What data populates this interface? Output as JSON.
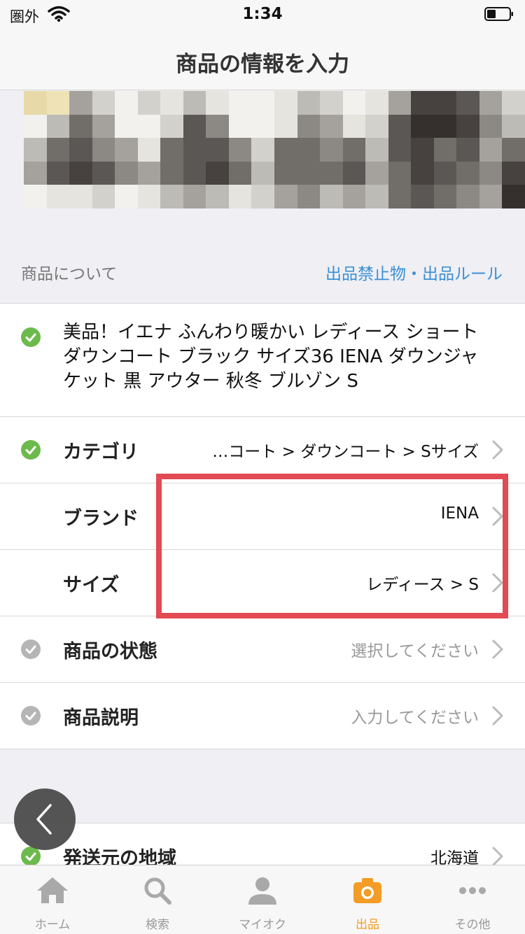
{
  "status_bar": {
    "carrier": "圏外",
    "time": "1:34"
  },
  "nav": {
    "title": "商品の情報を入力"
  },
  "section": {
    "label": "商品について",
    "link": "出品禁止物・出品ルール"
  },
  "listing": {
    "title": "美品！イエナ ふんわり暖かい レディース ショートダウンコート ブラック サイズ36 IENA ダウンジャケット 黒 アウター 秋冬 ブルゾン S"
  },
  "rows": [
    {
      "label": "カテゴリ",
      "value": "…コート > ダウンコート > Sサイズ",
      "status": "complete"
    },
    {
      "label": "ブランド",
      "value": "IENA",
      "status": "none"
    },
    {
      "label": "サイズ",
      "value": "レディース > S",
      "status": "none"
    },
    {
      "label": "商品の状態",
      "value": "選択してください",
      "status": "incomplete"
    },
    {
      "label": "商品説明",
      "value": "入力してください",
      "status": "incomplete"
    },
    {
      "label": "発送元の地域",
      "value": "北海道",
      "status": "complete"
    }
  ],
  "tabs": [
    {
      "label": "ホーム",
      "icon": "home-icon",
      "active": false
    },
    {
      "label": "検索",
      "icon": "search-icon",
      "active": false
    },
    {
      "label": "マイオク",
      "icon": "person-icon",
      "active": false
    },
    {
      "label": "出品",
      "icon": "camera-icon",
      "active": true
    },
    {
      "label": "その他",
      "icon": "more-icon",
      "active": false
    }
  ],
  "colors": {
    "accent": "#f39c26",
    "link": "#3b8fd6",
    "check_complete": "#6dba4c",
    "check_incomplete": "#b5b5b5",
    "highlight": "#e24a54"
  }
}
